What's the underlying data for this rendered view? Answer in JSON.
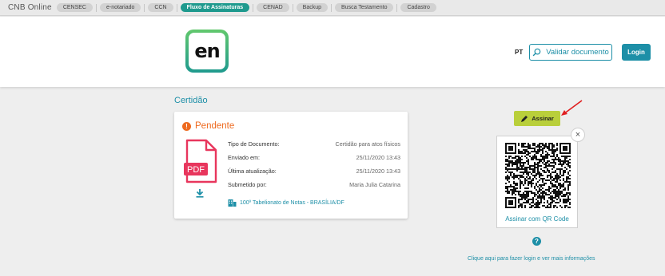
{
  "topbar": {
    "brand": "CNB Online",
    "items": [
      {
        "label": "CENSEC"
      },
      {
        "label": "e-notariado"
      },
      {
        "label": "CCN"
      },
      {
        "label": "Fluxo de Assinaturas",
        "active": true
      },
      {
        "label": "CENAD"
      },
      {
        "label": "Backup"
      },
      {
        "label": "Busca Testamento"
      },
      {
        "label": "Cadastro"
      }
    ]
  },
  "header": {
    "logo_text": "en",
    "lang": "PT",
    "validate_label": "Validar documento",
    "login_label": "Login"
  },
  "section_title": "Certidão",
  "card": {
    "status": "Pendente",
    "pdf_label": "PDF",
    "fields": [
      {
        "key": "Tipo de Documento:",
        "value": "Certidão para atos físicos"
      },
      {
        "key": "Enviado em:",
        "value": "25/11/2020 13:43"
      },
      {
        "key": "Última atualização:",
        "value": "25/11/2020 13:43"
      },
      {
        "key": "Submetido por:",
        "value": "Maria Julia Catarina"
      }
    ],
    "office": "100º Tabelionato de Notas - BRASÍLIA/DF"
  },
  "sign": {
    "label": "Assinar",
    "qr_label": "Assinar com QR Code",
    "help_link": "Clique aqui para fazer login e ver mais informações"
  },
  "colors": {
    "accent": "#1d8fa7",
    "active_tab": "#1f9a8e",
    "pending": "#ee6a1f",
    "sign_button": "#b9cf3b",
    "pdf": "#e8365d",
    "arrow": "#e02020"
  }
}
